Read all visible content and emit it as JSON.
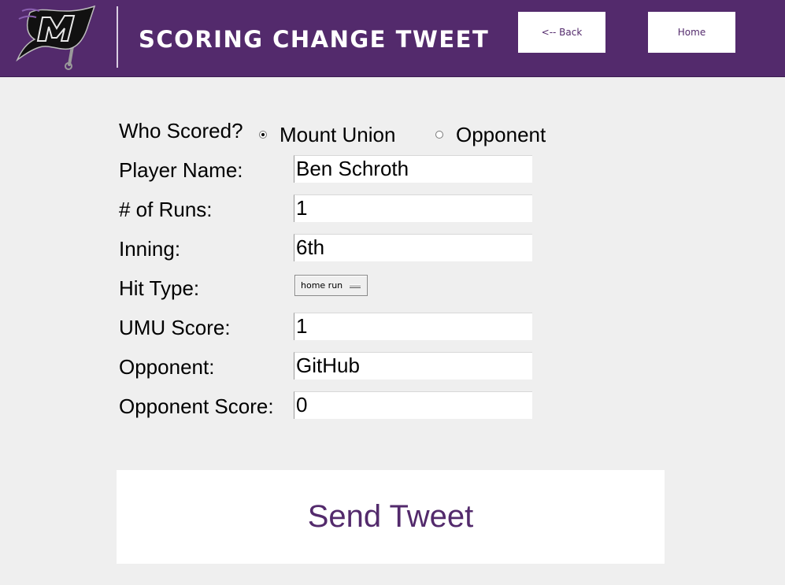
{
  "header": {
    "title": "SCORING CHANGE TWEET",
    "back_label": "<-- Back",
    "home_label": "Home",
    "logo_icon": "mount-union-flag-logo-icon",
    "brand_color": "#532a6c"
  },
  "form": {
    "who_scored": {
      "label": "Who Scored?",
      "options": [
        "Mount Union",
        "Opponent"
      ],
      "selected": "Mount Union"
    },
    "player_name": {
      "label": "Player Name:",
      "value": "Ben Schroth"
    },
    "runs": {
      "label": "# of Runs:",
      "value": "1"
    },
    "inning": {
      "label": "Inning:",
      "value": "6th"
    },
    "hit_type": {
      "label": "Hit Type:",
      "selected": "home run"
    },
    "umu_score": {
      "label": "UMU Score:",
      "value": "1"
    },
    "opponent": {
      "label": "Opponent:",
      "value": "GitHub"
    },
    "opponent_score": {
      "label": "Opponent Score:",
      "value": "0"
    }
  },
  "send_button": {
    "label": "Send Tweet"
  }
}
